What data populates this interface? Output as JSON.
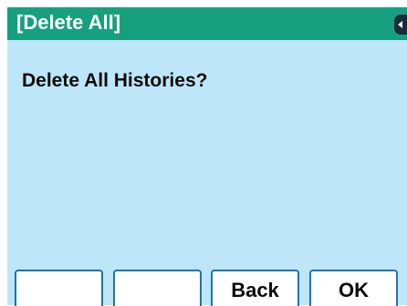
{
  "header": {
    "title": "[Delete All]",
    "scroll_indicator_icon": "left-arrow-icon"
  },
  "main": {
    "prompt": "Delete All Histories?"
  },
  "softkeys": [
    {
      "label": ""
    },
    {
      "label": ""
    },
    {
      "label": "Back"
    },
    {
      "label": "OK"
    }
  ],
  "colors": {
    "title_bar": "#17a07e",
    "screen_background": "#bde6f8",
    "softkey_border": "#1e73b6",
    "text": "#0b0b0b"
  }
}
